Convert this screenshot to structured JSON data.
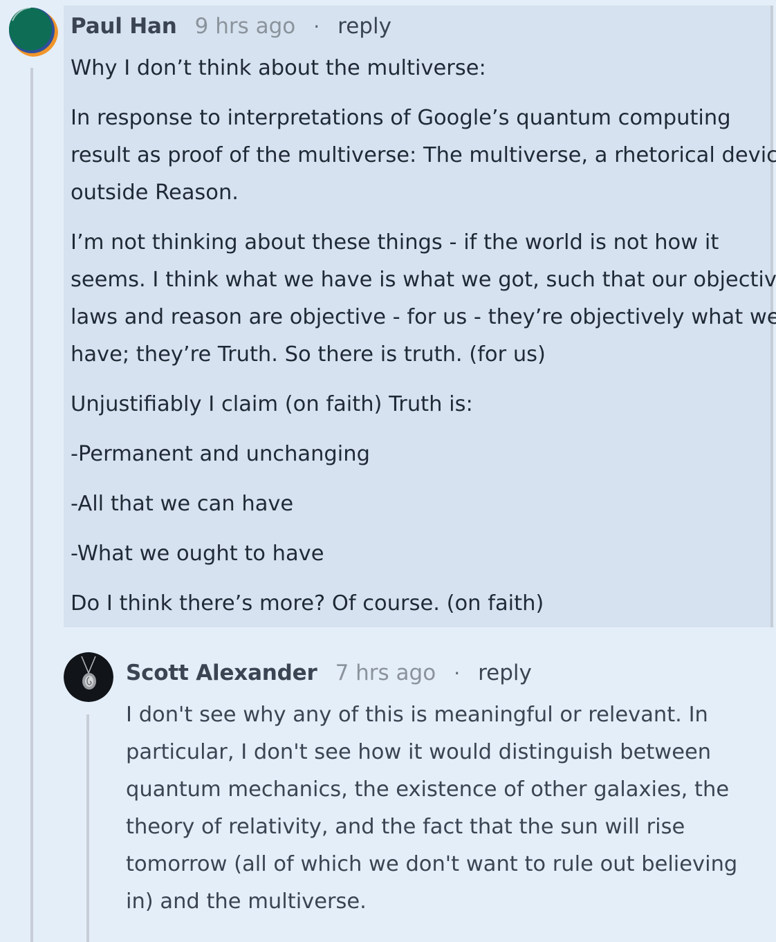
{
  "comment": {
    "author": "Paul Han",
    "time": "9 hrs ago",
    "separator": "·",
    "reply_label": "reply",
    "paragraphs": [
      {
        "lines": [
          "Why I don’t think about the multiverse:"
        ]
      },
      {
        "lines": [
          "In response to interpretations of Google’s quantum computing",
          "result as proof of the multiverse: The multiverse, a rhetorical device",
          "outside Reason."
        ]
      },
      {
        "lines": [
          "I’m not thinking about these things - if the world is not how it",
          "seems. I think what we have is what we got, such that our objective",
          "laws and reason are objective - for us - they’re objectively what we",
          "have; they’re Truth. So there is truth. (for us)"
        ]
      },
      {
        "lines": [
          "Unjustifiably I claim (on faith) Truth is:"
        ]
      },
      {
        "lines": [
          "-Permanent and unchanging"
        ]
      },
      {
        "lines": [
          "-All that we can have"
        ]
      },
      {
        "lines": [
          "-What we ought to have"
        ]
      },
      {
        "lines": [
          "Do I think there’s more? Of course. (on faith)"
        ]
      }
    ]
  },
  "reply": {
    "author": "Scott Alexander",
    "time": "7 hrs ago",
    "separator": "·",
    "reply_label": "reply",
    "paragraphs": [
      {
        "lines": [
          "I don't see why any of this is meaningful or relevant. In",
          "particular, I don't see how it would distinguish between",
          "quantum mechanics, the existence of other galaxies, the",
          "theory of relativity, and the fact that the sun will rise",
          "tomorrow (all of which we don't want to rule out believing",
          "in) and the multiverse."
        ]
      }
    ]
  },
  "colors": {
    "page_background": "#e4eef9",
    "highlight_background": "#d6e2ef",
    "thread_line": "#c7ced7"
  }
}
